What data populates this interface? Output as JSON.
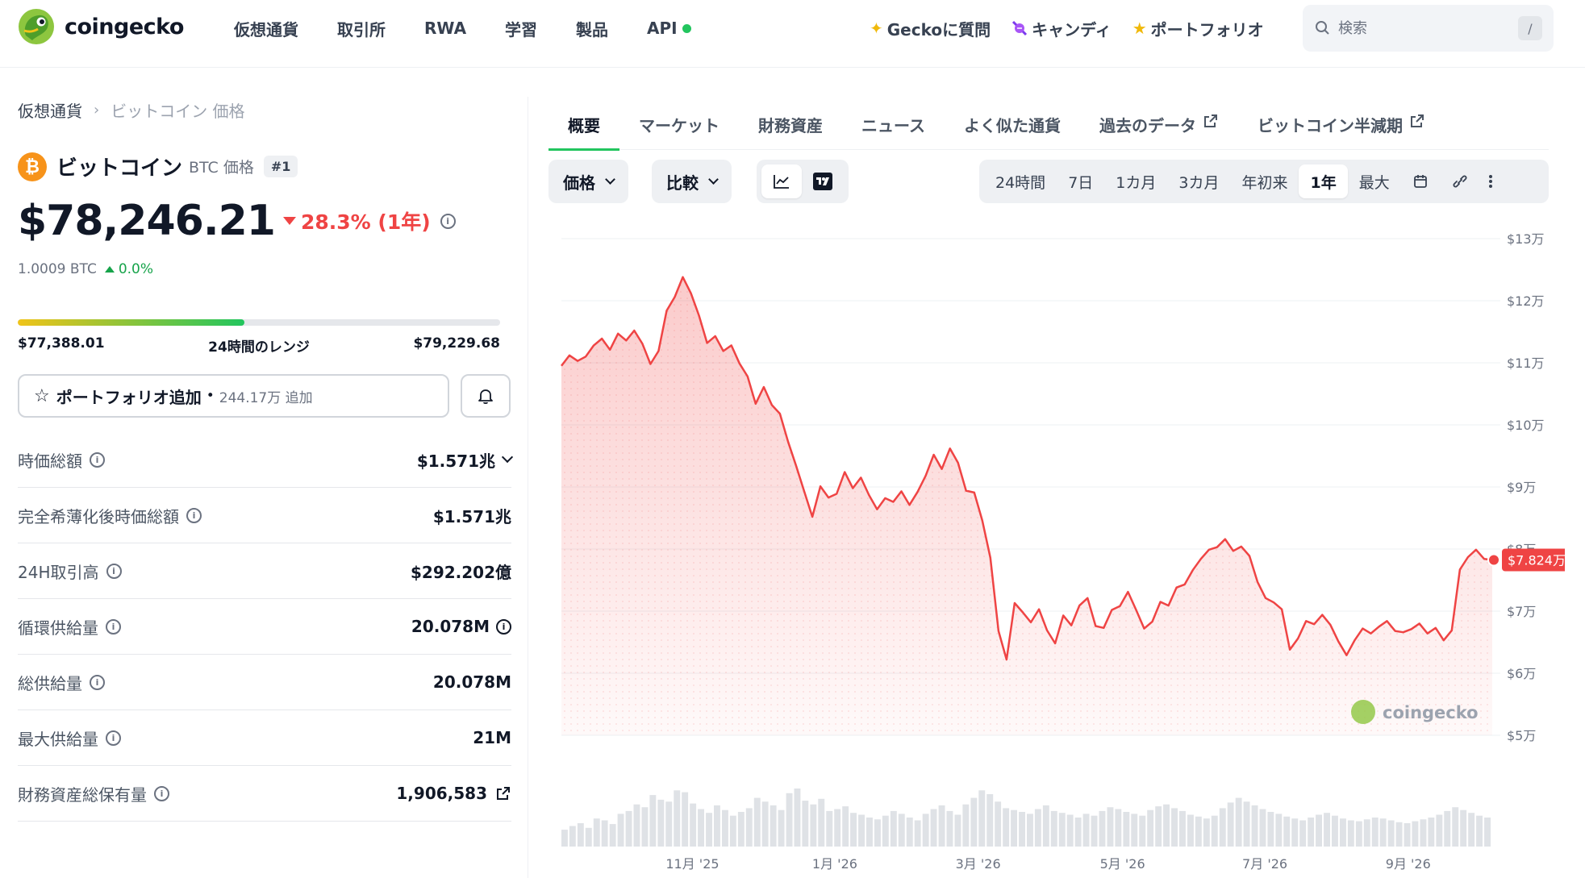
{
  "header": {
    "brand": "coingecko",
    "nav": [
      {
        "label": "仮想通貨"
      },
      {
        "label": "取引所"
      },
      {
        "label": "RWA"
      },
      {
        "label": "学習"
      },
      {
        "label": "製品"
      },
      {
        "label": "API"
      }
    ],
    "right_nav": [
      {
        "label": "Geckoに質問",
        "icon": "sparkle-icon"
      },
      {
        "label": "キャンディ",
        "icon": "candy-icon"
      },
      {
        "label": "ポートフォリオ",
        "icon": "star-icon"
      }
    ],
    "search": {
      "placeholder": "検索",
      "shortcut": "/"
    }
  },
  "breadcrumb": {
    "root": "仮想通貨",
    "current": "ビットコイン 価格"
  },
  "coin": {
    "name": "ビットコイン",
    "symbol_label": "BTC 価格",
    "rank": "#1",
    "price": "$78,246.21",
    "change": "28.3% (1年)",
    "btc_value": "1.0009 BTC",
    "btc_change": "0.0%",
    "range_low": "$77,388.01",
    "range_label": "24時間のレンジ",
    "range_high": "$79,229.68",
    "range_position": 0.47
  },
  "portfolio": {
    "label": "ポートフォリオ追加",
    "count": "244.17万 追加"
  },
  "stats": [
    {
      "label": "時価総額",
      "value": "$1.571兆"
    },
    {
      "label": "完全希薄化後時価総額",
      "value": "$1.571兆"
    },
    {
      "label": "24H取引高",
      "value": "$292.202億"
    },
    {
      "label": "循環供給量",
      "value": "20.078M"
    },
    {
      "label": "総供給量",
      "value": "20.078M"
    },
    {
      "label": "最大供給量",
      "value": "21M"
    },
    {
      "label": "財務資産総保有量",
      "value": "1,906,583"
    }
  ],
  "tabs": [
    {
      "label": "概要"
    },
    {
      "label": "マーケット"
    },
    {
      "label": "財務資産"
    },
    {
      "label": "ニュース"
    },
    {
      "label": "よく似た通貨"
    },
    {
      "label": "過去のデータ"
    },
    {
      "label": "ビットコイン半減期"
    }
  ],
  "toolbar": {
    "price_dd": "価格",
    "compare_dd": "比較",
    "ranges": [
      "24時間",
      "7日",
      "1カ月",
      "3カ月",
      "年初来",
      "1年",
      "最大"
    ],
    "active_range": "1年"
  },
  "colors": {
    "accent": "#22c55e",
    "down": "#ef4444",
    "up": "#16a34a",
    "line": "#ef4444"
  },
  "chart_data": {
    "type": "area",
    "x_ticks": [
      "11月 '25",
      "1月 '26",
      "3月 '26",
      "5月 '26",
      "7月 '26",
      "9月 '26"
    ],
    "y_ticks": [
      "$13万",
      "$12万",
      "$11万",
      "$10万",
      "$9万",
      "$8万",
      "$7万",
      "$6万",
      "$5万"
    ],
    "ylim": [
      50000,
      130000
    ],
    "current_label": "$7.824万",
    "current_value": 78246,
    "watermark": "coingecko",
    "values": [
      109500,
      111200,
      110300,
      111000,
      112800,
      113900,
      112100,
      114700,
      113600,
      115200,
      113100,
      109800,
      111900,
      118400,
      120600,
      123800,
      121200,
      117600,
      113200,
      114300,
      111900,
      112800,
      109900,
      107800,
      103400,
      106100,
      103200,
      101800,
      97300,
      93400,
      89300,
      85200,
      90100,
      88300,
      88900,
      92400,
      89800,
      91500,
      88700,
      86400,
      88200,
      87600,
      89300,
      87100,
      89200,
      91800,
      95200,
      92900,
      96200,
      93900,
      89400,
      89100,
      84600,
      78600,
      66800,
      62200,
      71300,
      69800,
      68200,
      70300,
      66900,
      64800,
      69300,
      67700,
      70900,
      72100,
      67600,
      67300,
      70200,
      70800,
      73100,
      70200,
      67200,
      68300,
      71500,
      70900,
      73800,
      74300,
      76600,
      78400,
      79900,
      80300,
      81600,
      79700,
      80400,
      78900,
      74700,
      72100,
      71400,
      70300,
      63800,
      65600,
      68400,
      67900,
      69400,
      67800,
      65100,
      62900,
      65300,
      67200,
      66400,
      67500,
      68400,
      66800,
      66600,
      67100,
      68000,
      66400,
      67300,
      65300,
      66900,
      76700,
      78700,
      79900,
      78400,
      78246
    ],
    "volume": [
      18,
      22,
      25,
      20,
      30,
      28,
      24,
      35,
      38,
      45,
      42,
      55,
      50,
      48,
      60,
      58,
      46,
      40,
      36,
      44,
      39,
      33,
      37,
      41,
      52,
      48,
      44,
      39,
      57,
      62,
      49,
      45,
      51,
      38,
      40,
      43,
      36,
      34,
      31,
      29,
      33,
      38,
      35,
      31,
      28,
      35,
      40,
      44,
      38,
      34,
      45,
      52,
      60,
      56,
      48,
      41,
      39,
      37,
      35,
      40,
      44,
      38,
      36,
      34,
      31,
      35,
      33,
      38,
      42,
      40,
      37,
      35,
      33,
      39,
      43,
      45,
      41,
      38,
      34,
      32,
      30,
      33,
      41,
      47,
      52,
      48,
      44,
      40,
      37,
      35,
      32,
      30,
      28,
      31,
      34,
      36,
      33,
      30,
      28,
      27,
      29,
      31,
      30,
      28,
      26,
      25,
      27,
      29,
      31,
      34,
      38,
      42,
      39,
      36,
      33,
      31
    ]
  }
}
